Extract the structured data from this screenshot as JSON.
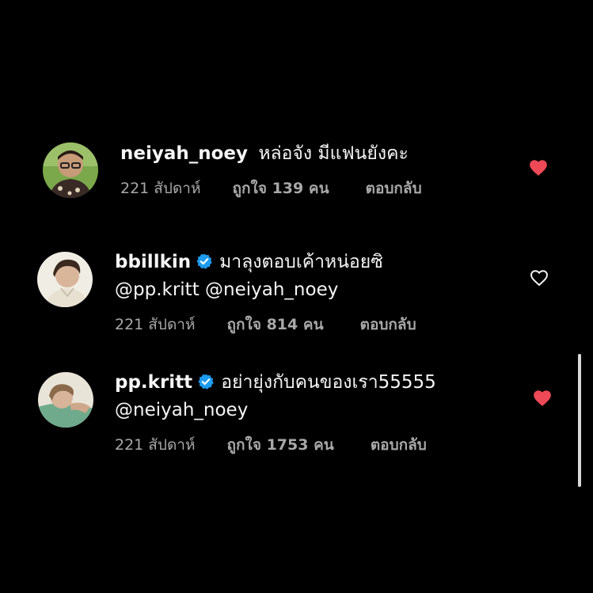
{
  "comments": [
    {
      "username": "neiyah_noey",
      "verified": false,
      "text": "หล่อจัง มีแฟนยังคะ",
      "mentions": "",
      "time": "221 สัปดาห์",
      "likes": "ถูกใจ 139 คน",
      "reply": "ตอบกลับ",
      "liked": true,
      "avatar_icon": "man-with-glasses-avatar"
    },
    {
      "username": "bbillkin",
      "verified": true,
      "text": "มาลุงตอบเค้าหน่อยซิ",
      "mentions": "@pp.kritt @neiyah_noey",
      "time": "221 สัปดาห์",
      "likes": "ถูกใจ 814 คน",
      "reply": "ตอบกลับ",
      "liked": false,
      "avatar_icon": "young-man-avatar"
    },
    {
      "username": "pp.kritt",
      "verified": true,
      "text": "อย่ายุ่งกับคนของเรา55555",
      "mentions": "@neiyah_noey",
      "time": "221 สัปดาห์",
      "likes": "ถูกใจ 1753 คน",
      "reply": "ตอบกลับ",
      "liked": true,
      "avatar_icon": "man-lying-on-pillow-avatar"
    }
  ],
  "colors": {
    "background": "#000000",
    "text": "#f5f5f5",
    "meta": "#a8a8a8",
    "heart_liked": "#ed4956",
    "verified_badge": "#1d9bf0"
  }
}
